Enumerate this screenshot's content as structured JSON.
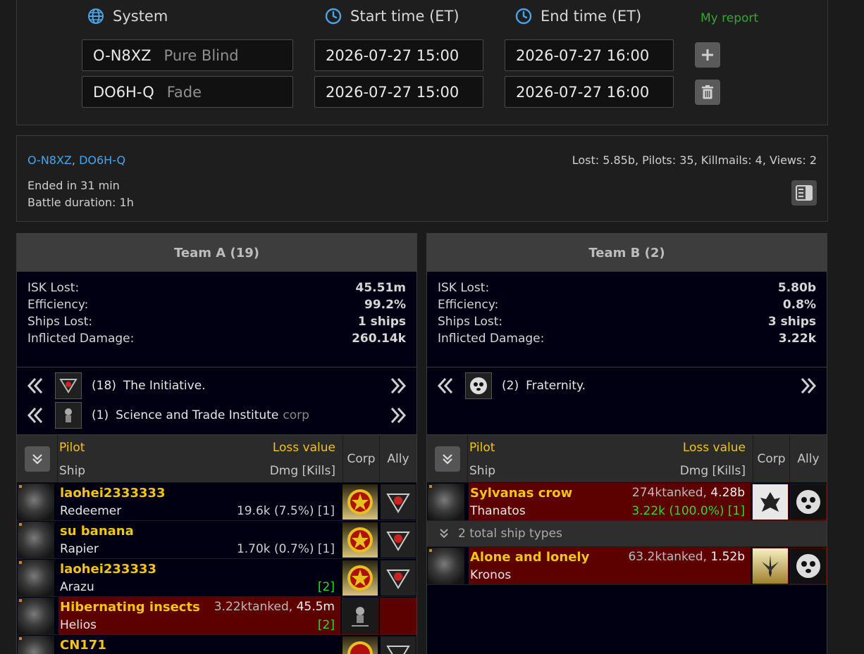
{
  "form": {
    "system_label": "System",
    "start_label": "Start time (ET)",
    "end_label": "End time (ET)",
    "my_report": "My report",
    "rows": [
      {
        "system": "O-N8XZ",
        "region": "Pure Blind",
        "start": "2026-07-27 15:00",
        "end": "2026-07-27 16:00"
      },
      {
        "system": "DO6H-Q",
        "region": "Fade",
        "start": "2026-07-27 15:00",
        "end": "2026-07-27 16:00"
      }
    ]
  },
  "summary": {
    "system_1": "O-N8XZ",
    "separator": ", ",
    "system_2": "DO6H-Q",
    "stats": "Lost: 5.85b, Pilots: 35, Killmails: 4, Views: 2",
    "ended": "Ended in 31 min",
    "duration": "Battle duration: 1h"
  },
  "labels": {
    "isk_lost": "ISK Lost:",
    "efficiency": "Efficiency:",
    "ships_lost": "Ships Lost:",
    "inflicted": "Inflicted Damage:",
    "pilot": "Pilot",
    "loss_value": "Loss value",
    "ship": "Ship",
    "dmg_kills": "Dmg [Kills]",
    "corp": "Corp",
    "ally": "Ally"
  },
  "team_a": {
    "title": "Team A (19)",
    "isk_lost": "45.51m",
    "efficiency": "99.2%",
    "ships_lost": "1 ships",
    "inflicted": "260.14k",
    "alliances": [
      {
        "count": "(18)",
        "name": "The Initiative.",
        "suffix": ""
      },
      {
        "count": "(1)",
        "name": "Science and Trade Institute",
        "suffix": "corp"
      }
    ],
    "pilots": [
      {
        "name": "laohei2333333",
        "ship": "Redeemer",
        "value": "",
        "dmg": "19.6k (7.5%)",
        "kills": "[1]"
      },
      {
        "name": "su banana",
        "ship": "Rapier",
        "value": "",
        "dmg": "1.70k (0.7%)",
        "kills": "[1]"
      },
      {
        "name": "laohei233333",
        "ship": "Arazu",
        "value": "",
        "dmg": "",
        "kills": "[2]"
      },
      {
        "name": "Hibernating insects",
        "ship": "Helios",
        "tanked": "3.22k",
        "tanked_word": "tanked,",
        "value": "45.5m",
        "dmg": "",
        "kills": "[2]"
      },
      {
        "name": "CN171",
        "ship": "",
        "value": "",
        "dmg": "",
        "kills": ""
      }
    ]
  },
  "team_b": {
    "title": "Team B (2)",
    "isk_lost": "5.80b",
    "efficiency": "0.8%",
    "ships_lost": "3 ships",
    "inflicted": "3.22k",
    "alliances": [
      {
        "count": "(2)",
        "name": "Fraternity.",
        "suffix": ""
      }
    ],
    "pilots": [
      {
        "name": "Sylvanas crow",
        "ship": "Thanatos",
        "tanked": "274k",
        "tanked_word": "tanked,",
        "value": "4.28b",
        "dmg": "3.22k (100.0%)",
        "kills": "[1]"
      },
      {
        "name": "Alone and lonely",
        "ship": "Kronos",
        "tanked": "63.2k",
        "tanked_word": "tanked,",
        "value": "1.52b",
        "dmg": "",
        "kills": ""
      }
    ],
    "types_text": "2 total ship types"
  },
  "colors": {
    "accent_yellow": "#f0c419",
    "link_blue": "#4da3e6",
    "loss_red": "#5c0000",
    "green": "#35d635"
  }
}
